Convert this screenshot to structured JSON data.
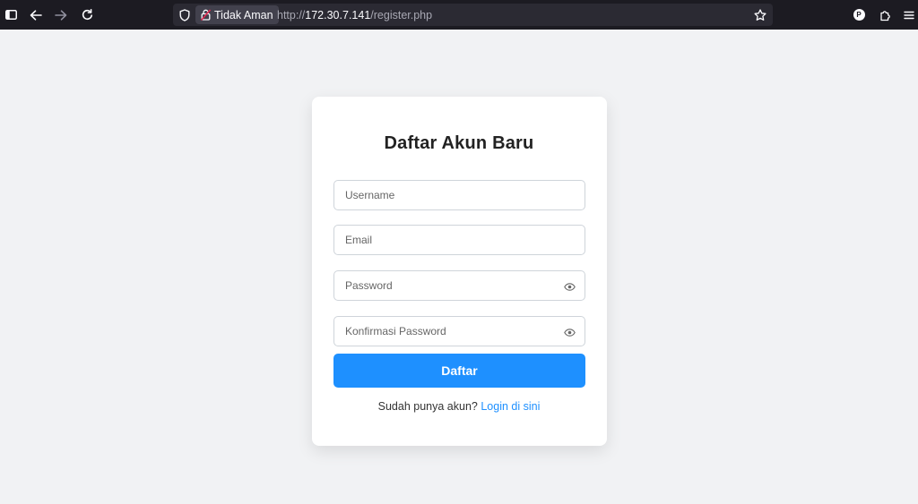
{
  "browser": {
    "security_label": "Tidak Aman",
    "url_protocol": "http://",
    "url_host": "172.30.7.141",
    "url_path": "/register.php",
    "profile_initial": "P"
  },
  "form": {
    "title": "Daftar Akun Baru",
    "username_placeholder": "Username",
    "email_placeholder": "Email",
    "password_placeholder": "Password",
    "confirm_placeholder": "Konfirmasi Password",
    "submit_label": "Daftar",
    "login_prompt": "Sudah punya akun?",
    "login_link": "Login di sini"
  },
  "colors": {
    "accent": "#1e90ff",
    "background": "#f1f2f4",
    "toolbar": "#1c1b22"
  }
}
